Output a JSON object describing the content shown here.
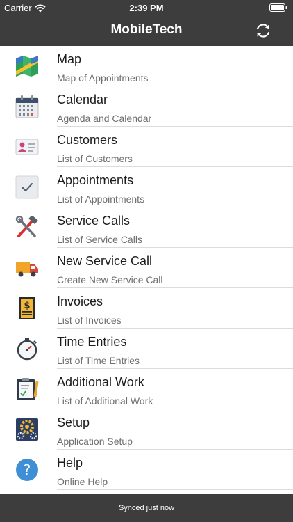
{
  "status_bar": {
    "carrier": "Carrier",
    "time": "2:39 PM",
    "icons": [
      "wifi-icon",
      "battery-icon"
    ]
  },
  "nav_bar": {
    "title": "MobileTech",
    "refresh_icon": "refresh-icon"
  },
  "menu": [
    {
      "title": "Map",
      "subtitle": "Map of Appointments",
      "icon": "map-icon"
    },
    {
      "title": "Calendar",
      "subtitle": "Agenda and Calendar",
      "icon": "calendar-icon"
    },
    {
      "title": "Customers",
      "subtitle": "List of Customers",
      "icon": "id-card-icon"
    },
    {
      "title": "Appointments",
      "subtitle": "List of Appointments",
      "icon": "checkmark-icon"
    },
    {
      "title": "Service Calls",
      "subtitle": "List of Service Calls",
      "icon": "hammer-wrench-icon"
    },
    {
      "title": "New Service Call",
      "subtitle": "Create New Service Call",
      "icon": "truck-icon"
    },
    {
      "title": "Invoices",
      "subtitle": "List of Invoices",
      "icon": "invoice-icon"
    },
    {
      "title": "Time Entries",
      "subtitle": "List of Time Entries",
      "icon": "stopwatch-icon"
    },
    {
      "title": "Additional Work",
      "subtitle": "List of Additional Work",
      "icon": "clipboard-icon"
    },
    {
      "title": "Setup",
      "subtitle": "Application Setup",
      "icon": "gears-icon"
    },
    {
      "title": "Help",
      "subtitle": "Online Help",
      "icon": "help-icon"
    }
  ],
  "footer": {
    "sync_status": "Synced just now"
  },
  "colors": {
    "bar_background": "#3d3d3d",
    "bar_text": "#ffffff",
    "title_text": "#1b1b1b",
    "subtitle_text": "#6e6e6e",
    "separator": "#dcdcdc"
  }
}
